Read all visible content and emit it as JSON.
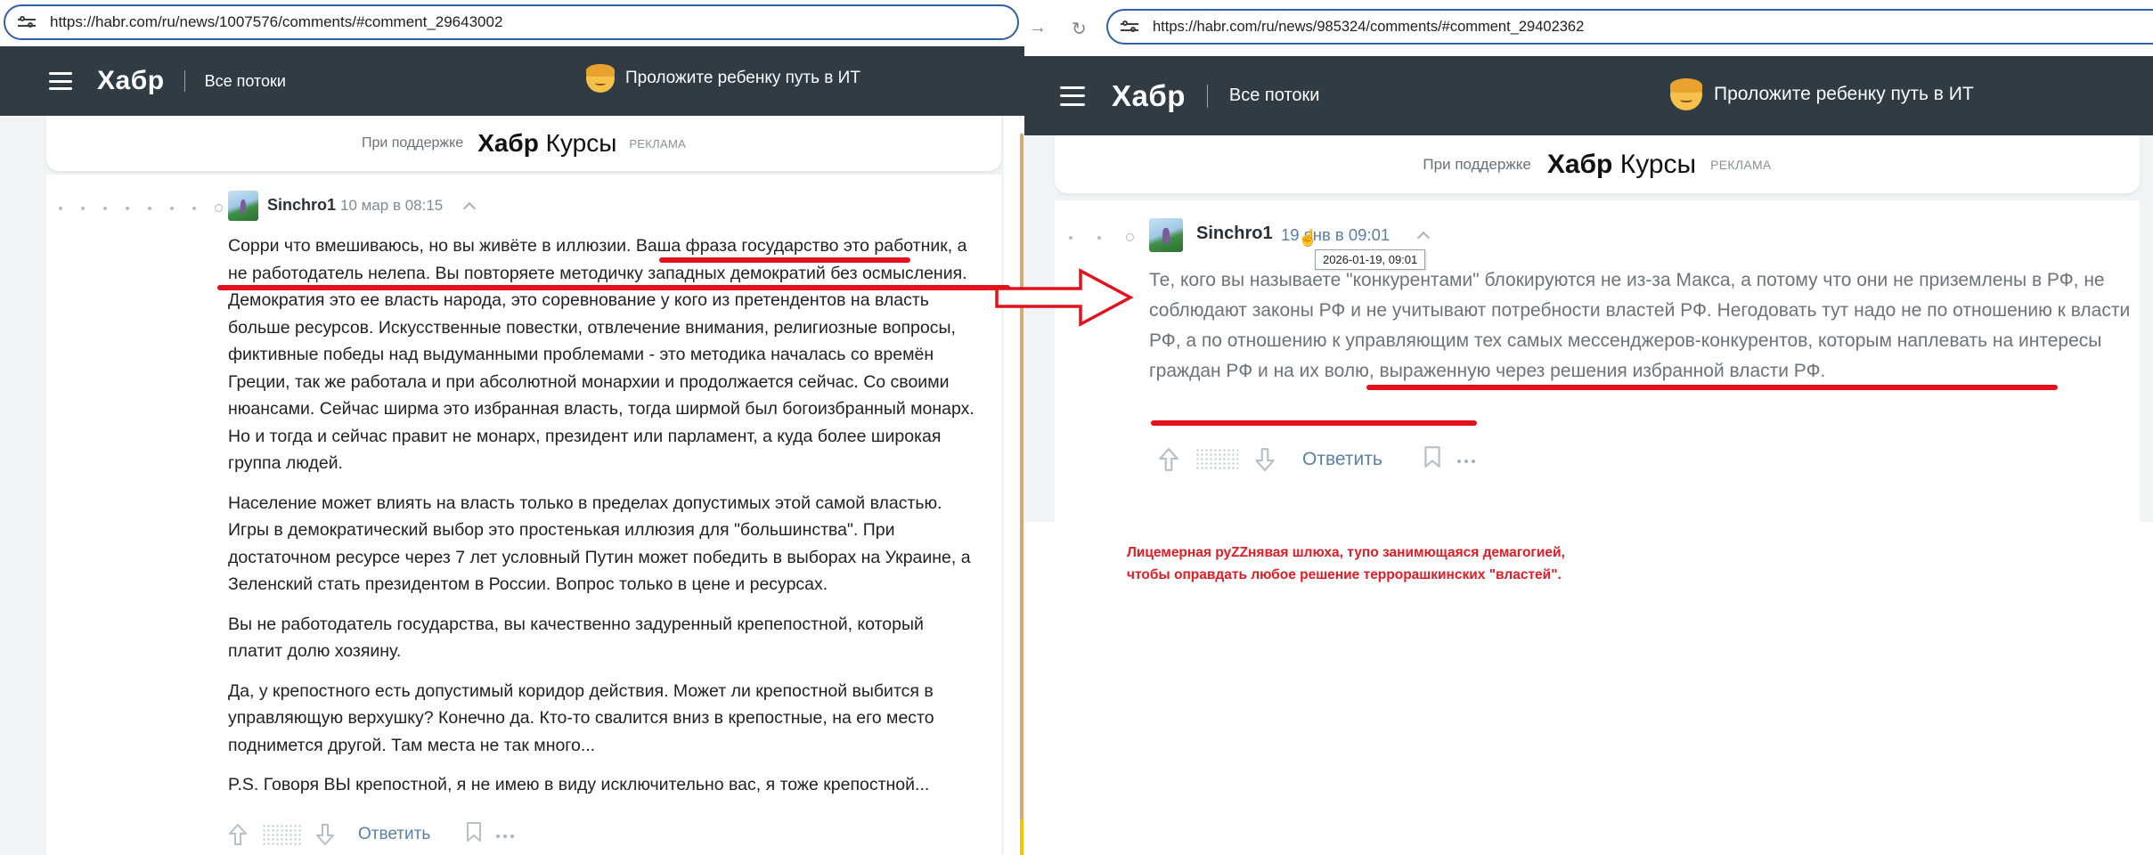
{
  "left": {
    "url": "https://habr.com/ru/news/1007576/comments/#comment_29643002",
    "header": {
      "logo": "Хабр",
      "streams": "Все потоки",
      "promo": "Проложите ребенку путь в ИТ"
    },
    "ad": {
      "support": "При поддержке",
      "brand_bold": "Хабр",
      "brand_light": "Курсы",
      "tag": "РЕКЛАМА"
    },
    "comment": {
      "author": "Sinchro1",
      "date": "10 мар в 08:15",
      "paragraphs": [
        "Сорри что вмешиваюсь, но вы живёте в иллюзии. Ваша фраза государство это работник, а не работодатель нелепа. Вы повторяете методичку западных демократий без осмысления. Демократия это ее власть народа, это соревнование у кого из претендентов на власть больше ресурсов. Искусственные повестки, отвлечение внимания, религиозные вопросы, фиктивные победы над выдуманными проблемами - это методика началась со времён Греции, так же работала и при абсолютной монархии и продолжается сейчас. Со своими нюансами. Сейчас ширма это избранная власть, тогда ширмой был богоизбранный монарх. Но и тогда и сейчас правит не монарх, президент или парламент, а куда более широкая группа людей.",
        "Население может влиять на власть только в пределах допустимых этой самой властью. Игры в демократический выбор это простенькая иллюзия для \"большинства\". При достаточном ресурсе через 7 лет условный Путин может победить в выборах на Украине, а Зеленский стать президентом в России. Вопрос только в цене и ресурсах.",
        "Вы не работодатель государства, вы качественно задуренный крепепостной, который платит долю хозяину.",
        "Да, у крепостного есть допустимый коридор действия. Может ли крепостной выбится в управляющую верхушку? Конечно да. Кто-то свалится вниз в крепостные, на его место поднимется другой. Там места не так много...",
        "P.S. Говоря ВЫ крепостной, я не имею в виду исключительно вас, я тоже крепостной..."
      ],
      "reply": "Ответить"
    }
  },
  "right": {
    "url": "https://habr.com/ru/news/985324/comments/#comment_29402362",
    "header": {
      "logo": "Хабр",
      "streams": "Все потоки",
      "promo": "Проложите ребенку путь в ИТ"
    },
    "ad": {
      "support": "При поддержке",
      "brand_bold": "Хабр",
      "brand_light": "Курсы",
      "tag": "РЕКЛАМА"
    },
    "comment": {
      "author": "Sinchro1",
      "date": "19 янв в 09:01",
      "tooltip": "2026-01-19, 09:01",
      "text": "Те, кого вы называете \"конкурентами\" блокируются не из-за Макса, а потому что они не приземлены в РФ, не соблюдают законы РФ и не учитывают потребности властей РФ. Негодовать тут надо не по отношению к власти РФ, а по отношению к управляющим тех самых мессенджеров-конкурентов, которым наплевать на интересы граждан РФ и на их волю, выраженную через решения избранной власти РФ.",
      "reply": "Ответить"
    },
    "annotation": {
      "line1": "Лицемерная руZZнявая шлюха, тупо занимющаяся демагогией,",
      "line2": "чтобы оправдать любое решение террорашкинских \"властей\"."
    }
  },
  "colors": {
    "header_bg": "#303b44",
    "accent_red": "#e3111b",
    "link": "#5a7fa6",
    "url_border": "#2e5fa8"
  }
}
